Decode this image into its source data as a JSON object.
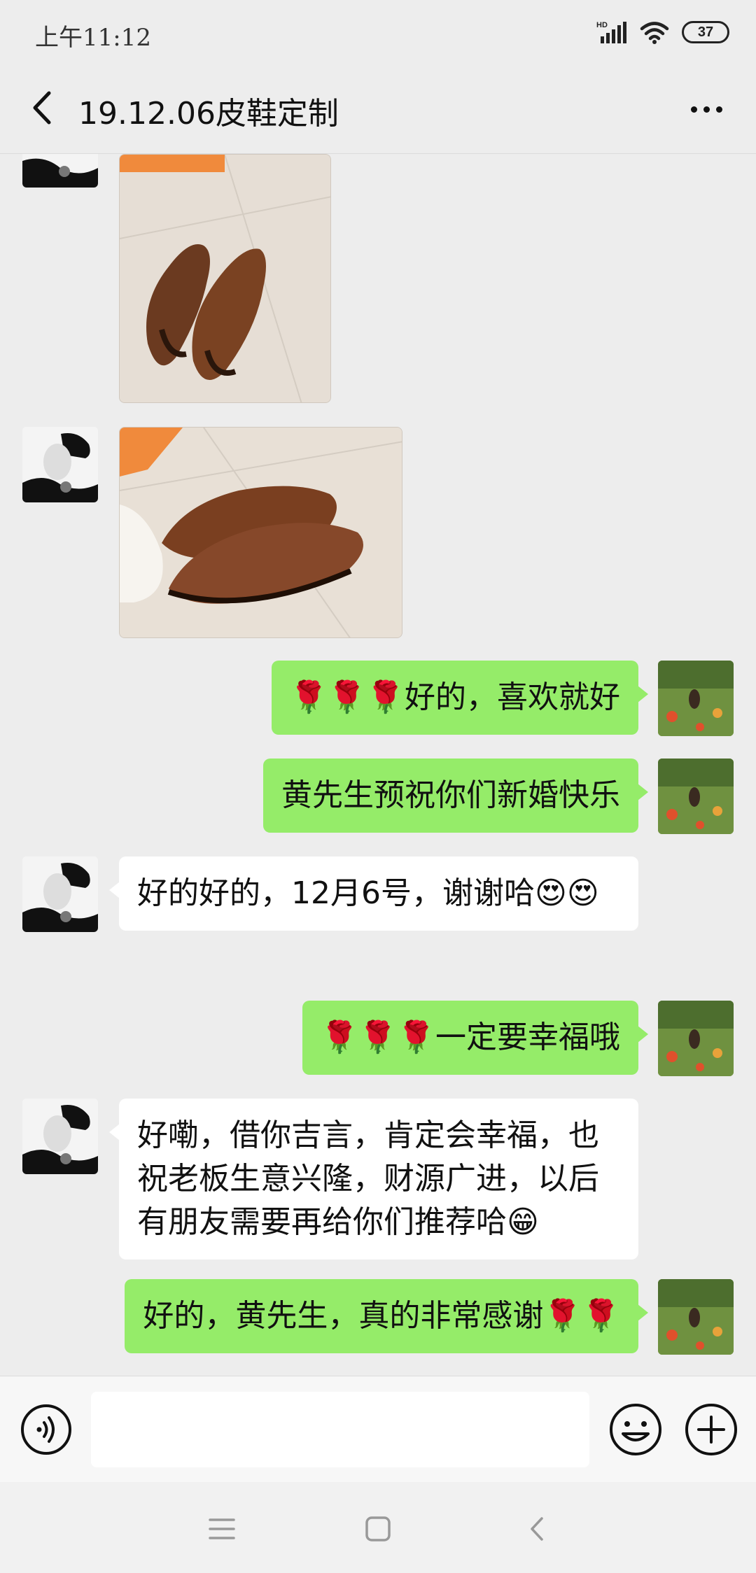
{
  "status_bar": {
    "time": "上午11:12",
    "network_label": "HD",
    "battery": "37"
  },
  "header": {
    "title": "19.12.06皮鞋定制"
  },
  "messages": [
    {
      "type": "image",
      "side": "left",
      "alt": "brown-leather-shoes-photo-1"
    },
    {
      "type": "image",
      "side": "left",
      "alt": "brown-leather-shoes-photo-2"
    },
    {
      "type": "text",
      "side": "right",
      "text": "🌹🌹🌹好的，喜欢就好"
    },
    {
      "type": "text",
      "side": "right",
      "text": "黄先生预祝你们新婚快乐"
    },
    {
      "type": "text",
      "side": "left",
      "text": "好的好的，12月6号，谢谢哈😍😍"
    },
    {
      "type": "text",
      "side": "right",
      "text": "🌹🌹🌹一定要幸福哦"
    },
    {
      "type": "text",
      "side": "left",
      "text": "好嘞，借你吉言，肯定会幸福，也祝老板生意兴隆，财源广进，以后有朋友需要再给你们推荐哈😁"
    },
    {
      "type": "text",
      "side": "right",
      "text": "好的，黄先生，真的非常感谢🌹🌹"
    }
  ],
  "input": {
    "value": "",
    "placeholder": ""
  },
  "colors": {
    "outgoing_bubble": "#95ec69",
    "incoming_bubble": "#ffffff",
    "background": "#ededed"
  },
  "icons": {
    "back": "chevron-left-icon",
    "more": "more-dots-icon",
    "voice": "voice-icon",
    "emoji": "emoji-icon",
    "plus": "plus-icon"
  }
}
